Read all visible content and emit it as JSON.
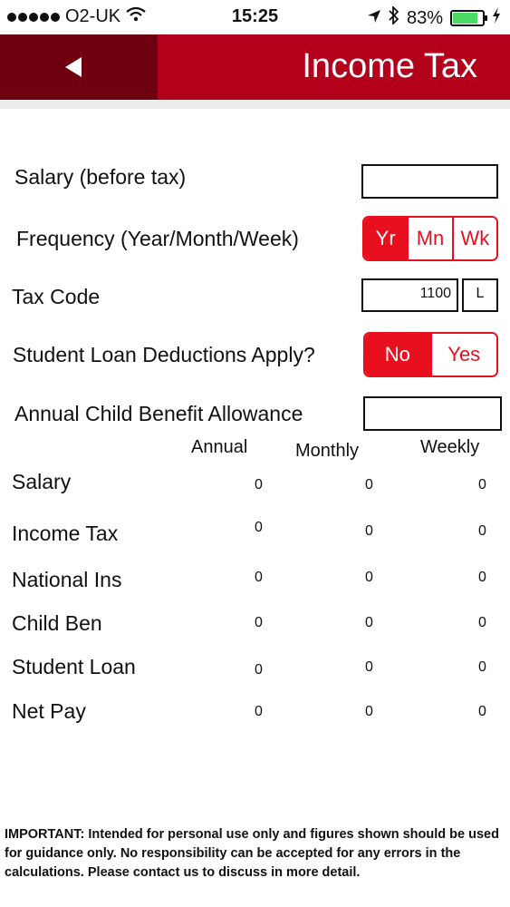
{
  "status_bar": {
    "carrier": "O2-UK",
    "time": "15:25",
    "battery_percent": "83%",
    "battery_level": 0.83
  },
  "header": {
    "title": "Income Tax",
    "color": "#b3001b",
    "back_color": "#6e0010"
  },
  "form": {
    "salary_label": "Salary (before tax)",
    "salary_value": "",
    "frequency_label": "Frequency (Year/Month/Week)",
    "frequency_options": [
      "Yr",
      "Mn",
      "Wk"
    ],
    "frequency_selected": "Yr",
    "tax_code_label": "Tax Code",
    "tax_code_number": "1100",
    "tax_code_letter": "L",
    "student_loan_label": "Student Loan Deductions Apply?",
    "student_loan_options": [
      "No",
      "Yes"
    ],
    "student_loan_selected": "No",
    "child_benefit_label": "Annual Child Benefit Allowance",
    "child_benefit_value": "",
    "accent_color": "#e8101f"
  },
  "results": {
    "columns": [
      "Annual",
      "Monthly",
      "Weekly"
    ],
    "rows": [
      {
        "label": "Salary",
        "values": [
          "0",
          "0",
          "0"
        ]
      },
      {
        "label": "Income Tax",
        "values": [
          "0",
          "0",
          "0"
        ]
      },
      {
        "label": "National Ins",
        "values": [
          "0",
          "0",
          "0"
        ]
      },
      {
        "label": "Child Ben",
        "values": [
          "0",
          "0",
          "0"
        ]
      },
      {
        "label": "Student Loan",
        "values": [
          "0",
          "0",
          "0"
        ]
      },
      {
        "label": "Net Pay",
        "values": [
          "0",
          "0",
          "0"
        ]
      }
    ]
  },
  "disclaimer": "IMPORTANT: Intended for personal use only and figures shown should be used for guidance only. No responsibility can be accepted for any errors in the calculations. Please contact us to discuss in more detail."
}
